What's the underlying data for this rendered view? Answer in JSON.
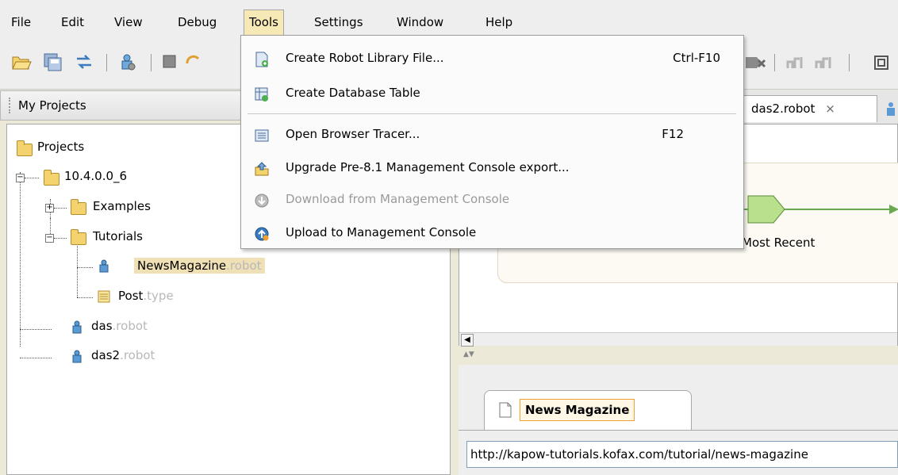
{
  "menubar": {
    "items": [
      {
        "label": "File"
      },
      {
        "label": "Edit"
      },
      {
        "label": "View"
      },
      {
        "label": "Debug"
      },
      {
        "label": "Tools"
      },
      {
        "label": "Settings"
      },
      {
        "label": "Window"
      },
      {
        "label": "Help"
      }
    ]
  },
  "tools_menu": {
    "items": [
      {
        "label": "Create Robot Library File...",
        "shortcut": "Ctrl-F10",
        "icon": "robot-library-file-icon"
      },
      {
        "label": "Create Database Table",
        "shortcut": "",
        "icon": "database-table-icon"
      },
      {
        "label": "Open Browser Tracer...",
        "shortcut": "F12",
        "icon": "browser-tracer-icon"
      },
      {
        "label": "Upgrade Pre-8.1 Management Console export...",
        "shortcut": "",
        "icon": "upgrade-icon"
      },
      {
        "label": "Download from Management Console",
        "shortcut": "",
        "icon": "download-icon",
        "disabled": true
      },
      {
        "label": "Upload to Management Console",
        "shortcut": "",
        "icon": "upload-icon"
      }
    ]
  },
  "left_panel": {
    "title": "My Projects"
  },
  "tree": {
    "root": "Projects",
    "project": "10.4.0.0_6",
    "examples": "Examples",
    "tutorials": "Tutorials",
    "news_name": "NewsMagazine",
    "news_ext": ".robot",
    "post_name": "Post",
    "post_ext": ".type",
    "das_name": "das",
    "das_ext": ".robot",
    "das2_name": "das2",
    "das2_ext": ".robot"
  },
  "editor": {
    "tab_label": "das2.robot",
    "tab_close": "×",
    "step_label": "Most Recent"
  },
  "lower": {
    "tab_title": "News Magazine",
    "url": "http://kapow-tutorials.kofax.com/tutorial/news-magazine"
  },
  "colors": {
    "menu_highlight": "#f7e9b6",
    "selection": "#efe0b5",
    "step_green": "#b9e08c",
    "arrow_green": "#6aa84f"
  }
}
